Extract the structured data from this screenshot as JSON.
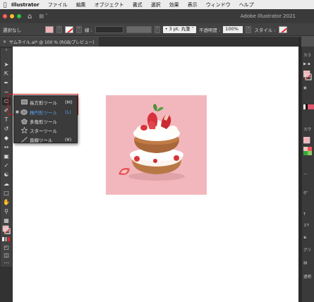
{
  "menubar": {
    "apple": "",
    "app": "Illustrator",
    "items": [
      "ファイル",
      "編集",
      "オブジェクト",
      "書式",
      "選択",
      "効果",
      "表示",
      "ウィンドウ",
      "ヘルプ"
    ]
  },
  "appbar": {
    "title": "Adobe Illustrator 2021",
    "workspace_icon": "grid-icon",
    "traffic_colors": [
      "#ff5f57",
      "#febc2e",
      "#28c840"
    ]
  },
  "control": {
    "selection": "選択なし",
    "stroke_label": "線 :",
    "stroke_style": "3 pt. 丸筆",
    "opacity_label": "不透明度 :",
    "opacity_value": "100%",
    "style_label": "スタイル :",
    "fill_color": "#f0b4b8"
  },
  "tab": {
    "close": "×",
    "title": "サムネイル.ai* @ 100 % (RGB/プレビュー)"
  },
  "flyout": {
    "items": [
      {
        "label": "長方形ツール",
        "key": "(M)",
        "bullet": "",
        "icon": "rectangle-icon"
      },
      {
        "label": "楕円形ツール",
        "key": "(L)",
        "bullet": "■",
        "icon": "ellipse-icon"
      },
      {
        "label": "多角形ツール",
        "key": "",
        "bullet": "",
        "icon": "polygon-icon"
      },
      {
        "label": "スターツール",
        "key": "",
        "bullet": "",
        "icon": "star-icon"
      },
      {
        "label": "直線ツール",
        "key": "(¥)",
        "bullet": "",
        "icon": "line-icon"
      }
    ]
  },
  "rightpanel": {
    "labels": [
      "カラ",
      "スウ",
      "グリ",
      "透明"
    ]
  }
}
